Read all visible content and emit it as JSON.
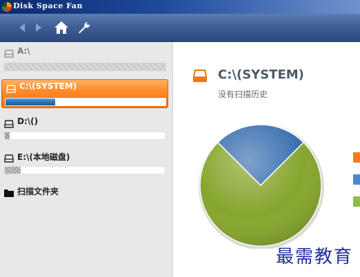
{
  "app": {
    "title": "Disk Space Fan"
  },
  "toolbar": {
    "icons": [
      "back-icon",
      "forward-icon",
      "home-icon",
      "settings-icon"
    ]
  },
  "drives": [
    {
      "label": "A:\\",
      "usage": 0.0,
      "state": "disabled"
    },
    {
      "label": "C:\\(SYSTEM)",
      "usage": 0.31,
      "state": "selected"
    },
    {
      "label": "D:\\()",
      "usage": 0.03,
      "state": "normal"
    },
    {
      "label": "E:\\(本地磁盘)",
      "usage": 0.1,
      "state": "normal"
    }
  ],
  "scan_folder": {
    "label": "扫描文件夹"
  },
  "main": {
    "drive_title": "C:\\(SYSTEM)",
    "scan_history": "没有扫描历史"
  },
  "chart_data": {
    "type": "pie",
    "slices": [
      {
        "value": 25,
        "color": "#3a6fb0"
      },
      {
        "value": 75,
        "color": "#86a52d"
      }
    ]
  },
  "legend_colors": [
    "#ff7a1a",
    "#4a8acb",
    "#8cbf4a"
  ],
  "watermark": "最需教育",
  "colors": {
    "accent": "#ff7f1f",
    "titlebar": "#0b2a6e",
    "toolbar": "#3f5f95"
  }
}
